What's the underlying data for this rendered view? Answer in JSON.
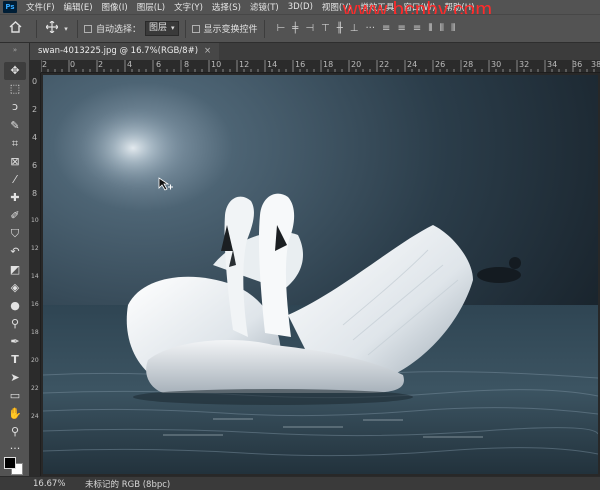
{
  "app": {
    "logo": "Ps",
    "watermark": "www.bcnbv.com"
  },
  "menu": [
    "文件(F)",
    "编辑(E)",
    "图像(I)",
    "图层(L)",
    "文字(Y)",
    "选择(S)",
    "滤镜(T)",
    "3D(D)",
    "视图(V)",
    "增效工具",
    "窗口(W)",
    "帮助(H)"
  ],
  "options": {
    "auto_select_label": "自动选择：",
    "auto_select_value": "图层",
    "show_transform_label": "显示变换控件"
  },
  "document": {
    "tab_title": "swan-4013225.jpg @ 16.7%(RGB/8#)",
    "close_glyph": "×"
  },
  "ruler": {
    "h_ticks": [
      "2",
      "0",
      "2",
      "4",
      "6",
      "8",
      "10",
      "12",
      "14",
      "16",
      "18",
      "20",
      "22",
      "24",
      "26",
      "28",
      "30",
      "32",
      "34",
      "36",
      "38"
    ],
    "v_ticks": [
      "0",
      "2",
      "4",
      "6",
      "8",
      "10",
      "12",
      "14",
      "16",
      "18",
      "20",
      "22",
      "24"
    ]
  },
  "status": {
    "zoom": "16.67%",
    "profile": "未标记的 RGB (8bpc)"
  },
  "icons": {
    "home": "home-icon",
    "move": "move-icon"
  },
  "colors": {
    "panel": "#535353",
    "canvas_bg": "#282828",
    "watermark": "#ff2a2a"
  }
}
